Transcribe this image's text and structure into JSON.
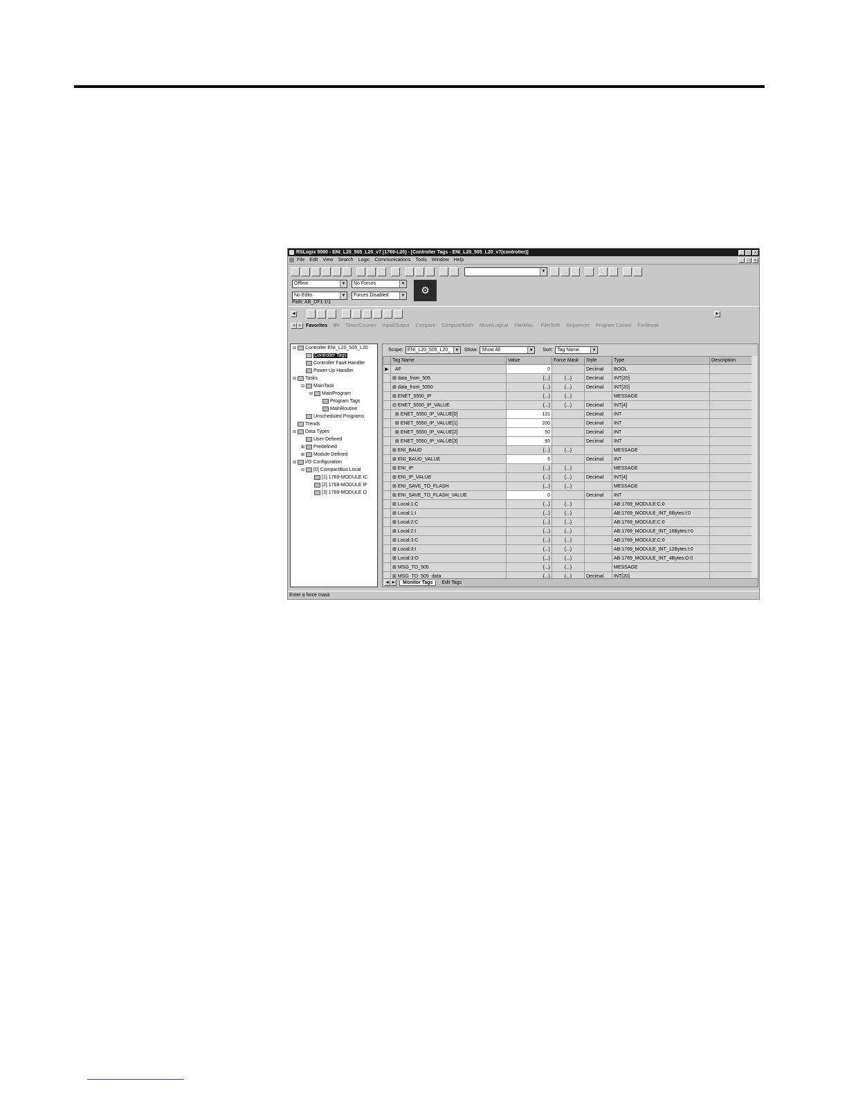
{
  "window": {
    "title": "RSLogix 5000 - ENI_L20_505_L20_v7 [1769-L20] - [Controller Tags - ENI_L20_505_L20_v7(controller)]",
    "title_buttons": [
      "_",
      "□",
      "x"
    ],
    "mdi_buttons": [
      "_",
      "□",
      "x"
    ]
  },
  "menu": [
    "File",
    "Edit",
    "View",
    "Search",
    "Logic",
    "Communications",
    "Tools",
    "Window",
    "Help"
  ],
  "status": {
    "mode": "Offline",
    "forces": "No Forces",
    "edits": "No Edits",
    "forces_state": "Forces Disabled",
    "path": "Path: AB_DF1-1\\1"
  },
  "instruction_tabs": [
    "Favorites",
    "Bit",
    "Timer/Counter",
    "Input/Output",
    "Compare",
    "Compute/Math",
    "Move/Logical",
    "File/Misc.",
    "File/Shift",
    "Sequencer",
    "Program Control",
    "For/Break"
  ],
  "organizer": [
    {
      "depth": 0,
      "exp": "⊟",
      "label": "Controller ENI_L20_505_L20"
    },
    {
      "depth": 1,
      "exp": "",
      "label": "Controller Tags",
      "selected": true
    },
    {
      "depth": 1,
      "exp": "",
      "label": "Controller Fault Handler"
    },
    {
      "depth": 1,
      "exp": "",
      "label": "Power-Up Handler"
    },
    {
      "depth": 0,
      "exp": "⊟",
      "label": "Tasks"
    },
    {
      "depth": 1,
      "exp": "⊟",
      "label": "MainTask"
    },
    {
      "depth": 2,
      "exp": "⊟",
      "label": "MainProgram"
    },
    {
      "depth": 3,
      "exp": "",
      "label": "Program Tags"
    },
    {
      "depth": 3,
      "exp": "",
      "label": "MainRoutine"
    },
    {
      "depth": 1,
      "exp": "",
      "label": "Unscheduled Programs"
    },
    {
      "depth": 0,
      "exp": "",
      "label": "Trends"
    },
    {
      "depth": 0,
      "exp": "⊟",
      "label": "Data Types"
    },
    {
      "depth": 1,
      "exp": "",
      "label": "User-Defined"
    },
    {
      "depth": 1,
      "exp": "⊞",
      "label": "Predefined"
    },
    {
      "depth": 1,
      "exp": "⊞",
      "label": "Module-Defined"
    },
    {
      "depth": 0,
      "exp": "⊟",
      "label": "I/O Configuration"
    },
    {
      "depth": 1,
      "exp": "⊟",
      "label": "[0] CompactBus Local"
    },
    {
      "depth": 2,
      "exp": "",
      "label": "[1] 1769-MODULE IC"
    },
    {
      "depth": 2,
      "exp": "",
      "label": "[2] 1769-MODULE IF"
    },
    {
      "depth": 2,
      "exp": "",
      "label": "[3] 1769-MODULE O"
    }
  ],
  "filters": {
    "scope_label": "Scope:",
    "scope_value": "ENI_L20_505_L20_",
    "show_label": "Show:",
    "show_value": "Show All",
    "sort_label": "Sort:",
    "sort_value": "Tag Name"
  },
  "columns": [
    "Tag Name",
    "Value",
    "Force Mask",
    "Style",
    "Type",
    "Description"
  ],
  "rows": [
    {
      "name": "AF",
      "value": "0",
      "force": "",
      "style": "Decimal",
      "type": "BOOL",
      "white": true,
      "current": true
    },
    {
      "name": "data_from_505",
      "value": "{...}",
      "force": "{...}",
      "style": "Decimal",
      "type": "INT[20]"
    },
    {
      "name": "data_from_5550",
      "value": "{...}",
      "force": "{...}",
      "style": "Decimal",
      "type": "INT[20]"
    },
    {
      "name": "ENET_5550_IP",
      "value": "{...}",
      "force": "{...}",
      "style": "",
      "type": "MESSAGE"
    },
    {
      "name": "ENET_5550_IP_VALUE",
      "value": "{...}",
      "force": "{...}",
      "style": "Decimal",
      "type": "INT[4]"
    },
    {
      "name": "ENET_5550_IP_VALUE[0]",
      "value": "131",
      "force": "",
      "style": "Decimal",
      "type": "INT",
      "white": true,
      "child": true
    },
    {
      "name": "ENET_5550_IP_VALUE[1]",
      "value": "200",
      "force": "",
      "style": "Decimal",
      "type": "INT",
      "white": true,
      "child": true
    },
    {
      "name": "ENET_5550_IP_VALUE[2]",
      "value": "50",
      "force": "",
      "style": "Decimal",
      "type": "INT",
      "white": true,
      "child": true
    },
    {
      "name": "ENET_5550_IP_VALUE[3]",
      "value": "93",
      "force": "",
      "style": "Decimal",
      "type": "INT",
      "white": true,
      "child": true
    },
    {
      "name": "ENI_BAUD",
      "value": "{...}",
      "force": "{...}",
      "style": "",
      "type": "MESSAGE"
    },
    {
      "name": "ENI_BAUD_VALUE",
      "value": "6",
      "force": "",
      "style": "Decimal",
      "type": "INT",
      "white": true
    },
    {
      "name": "ENI_IP",
      "value": "{...}",
      "force": "{...}",
      "style": "",
      "type": "MESSAGE"
    },
    {
      "name": "ENI_IP_VALUE",
      "value": "{...}",
      "force": "{...}",
      "style": "Decimal",
      "type": "INT[4]"
    },
    {
      "name": "ENI_SAVE_TO_FLASH",
      "value": "{...}",
      "force": "{...}",
      "style": "",
      "type": "MESSAGE"
    },
    {
      "name": "ENI_SAVE_TO_FLASH_VALUE",
      "value": "0",
      "force": "",
      "style": "Decimal",
      "type": "INT",
      "white": true
    },
    {
      "name": "Local:1:C",
      "value": "{...}",
      "force": "{...}",
      "style": "",
      "type": "AB:1769_MODULE:C:0"
    },
    {
      "name": "Local:1:I",
      "value": "{...}",
      "force": "{...}",
      "style": "",
      "type": "AB:1769_MODULE_INT_6Bytes:I:0"
    },
    {
      "name": "Local:2:C",
      "value": "{...}",
      "force": "{...}",
      "style": "",
      "type": "AB:1769_MODULE:C:0"
    },
    {
      "name": "Local:2:I",
      "value": "{...}",
      "force": "{...}",
      "style": "",
      "type": "AB:1769_MODULE_INT_16Bytes:I:0"
    },
    {
      "name": "Local:3:C",
      "value": "{...}",
      "force": "{...}",
      "style": "",
      "type": "AB:1769_MODULE:C:0"
    },
    {
      "name": "Local:3:I",
      "value": "{...}",
      "force": "{...}",
      "style": "",
      "type": "AB:1769_MODULE_INT_12Bytes:I:0"
    },
    {
      "name": "Local:3:O",
      "value": "{...}",
      "force": "{...}",
      "style": "",
      "type": "AB:1769_MODULE_INT_4Bytes:O:0"
    },
    {
      "name": "MSG_TO_505",
      "value": "{...}",
      "force": "{...}",
      "style": "",
      "type": "MESSAGE"
    },
    {
      "name": "MSG_TO_505_data",
      "value": "{...}",
      "force": "{...}",
      "style": "Decimal",
      "type": "INT[20]"
    }
  ],
  "sheet_tabs": [
    "Monitor Tags",
    "Edit Tags"
  ],
  "statusbar": "Enter a force mask"
}
